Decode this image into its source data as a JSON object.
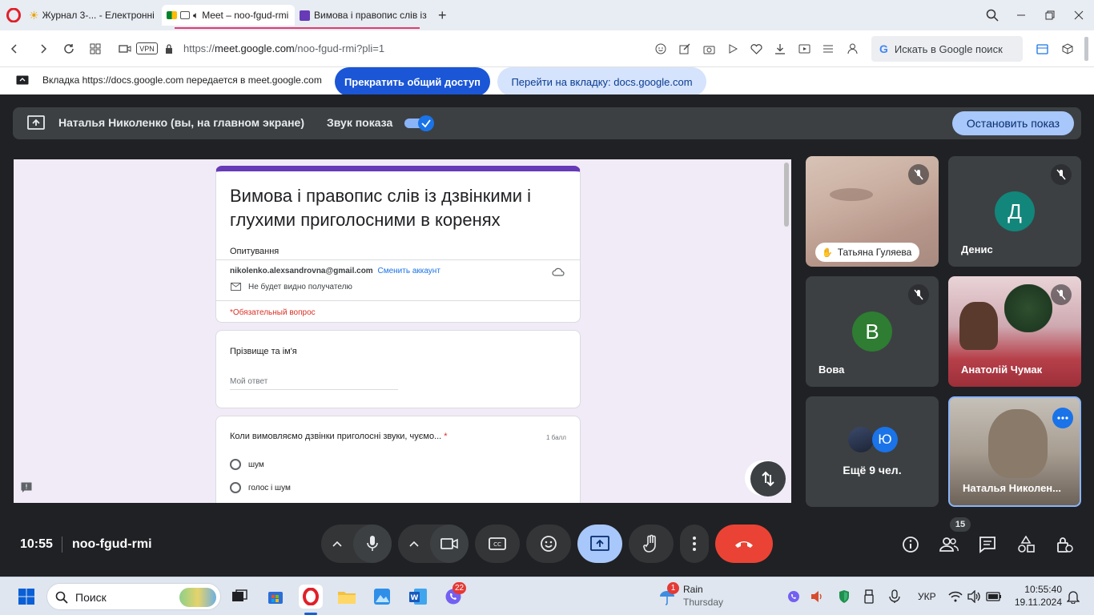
{
  "browser": {
    "tabs": [
      {
        "label": "Журнал 3-... - Електронні"
      },
      {
        "label": "Meet – noo-fgud-rmi"
      },
      {
        "label": "Вимова і правопис слів із"
      }
    ],
    "url_prefix": "https://",
    "url_host": "meet.google.com",
    "url_path": "/noo-fgud-rmi?pli=1",
    "vpn_label": "VPN",
    "search_placeholder": "Искать в Google поиск"
  },
  "share_bar": {
    "message": "Вкладка https://docs.google.com передается в meet.google.com",
    "stop_label": "Прекратить общий доступ",
    "goto_label": "Перейти на вкладку: docs.google.com"
  },
  "meet": {
    "presenting_title": "Наталья Николенко (вы, на главном экране)",
    "audio_label": "Звук показа",
    "stop_presenting_label": "Остановить показ",
    "clock": "10:55",
    "meeting_code": "noo-fgud-rmi",
    "participants_count": "15"
  },
  "form": {
    "title": "Вимова і правопис слів із дзвінкими і глухими приголосними в коренях",
    "subtitle": "Опитування",
    "account_email": "nikolenko.alexsandrovna@gmail.com",
    "switch_account": "Сменить аккаунт",
    "not_visible": "Не будет видно получателю",
    "required_note": "*Обязательный вопрос",
    "q1_title": "Прізвище та ім'я",
    "q1_placeholder": "Мой ответ",
    "q2_title": "Коли вимовляємо дзвінки приголосні звуки, чуємо...",
    "q2_required": "*",
    "q2_points": "1 балл",
    "q2_options": [
      "шум",
      "голос і шум"
    ]
  },
  "tiles": [
    {
      "name": "Татьяна Гуляева"
    },
    {
      "name": "Денис",
      "initial": "Д",
      "color": "#12867a"
    },
    {
      "name": "Вова",
      "initial": "В",
      "color": "#2e7d32"
    },
    {
      "name": "Анатолій Чумак"
    },
    {
      "name": "Ещё 9 чел.",
      "initial": "Ю",
      "color": "#1a73e8"
    },
    {
      "name": "Наталья Николен..."
    }
  ],
  "taskbar": {
    "search_label": "Поиск",
    "viber_badge": "22",
    "weather_badge": "1",
    "weather_title": "Rain",
    "weather_day": "Thursday",
    "language": "УКР",
    "time": "10:55:40",
    "date": "19.11.2024"
  }
}
